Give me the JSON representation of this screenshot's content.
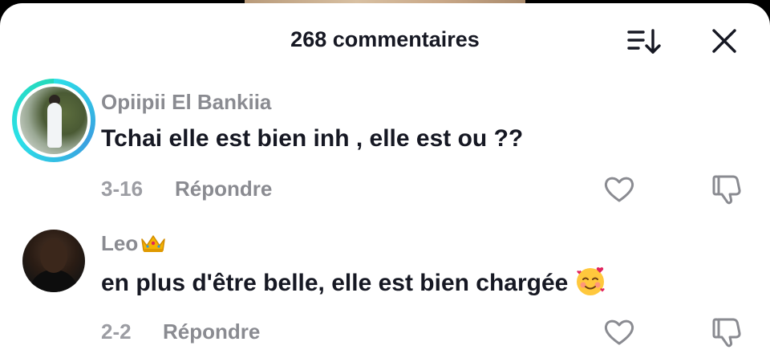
{
  "header": {
    "title": "268 commentaires"
  },
  "icons": {
    "sort": "sort-icon",
    "close": "close-icon",
    "like": "heart-icon",
    "dislike": "thumbs-down-icon"
  },
  "comments": [
    {
      "username": "Opiipii El Bankiia",
      "text": "Tchai elle est bien inh , elle est ou ??",
      "date": "3-16",
      "reply_label": "Répondre",
      "avatar_ring": true
    },
    {
      "username": "Leo",
      "username_emoji": "crown",
      "text": "en plus d'être belle, elle est bien chargée",
      "text_emoji": "smiling-face-with-hearts",
      "date": "2-2",
      "reply_label": "Répondre",
      "avatar_ring": false
    }
  ],
  "colors": {
    "ring_gradient": "#2be0e8",
    "text_primary": "#161823",
    "text_secondary": "#8a8b91"
  }
}
